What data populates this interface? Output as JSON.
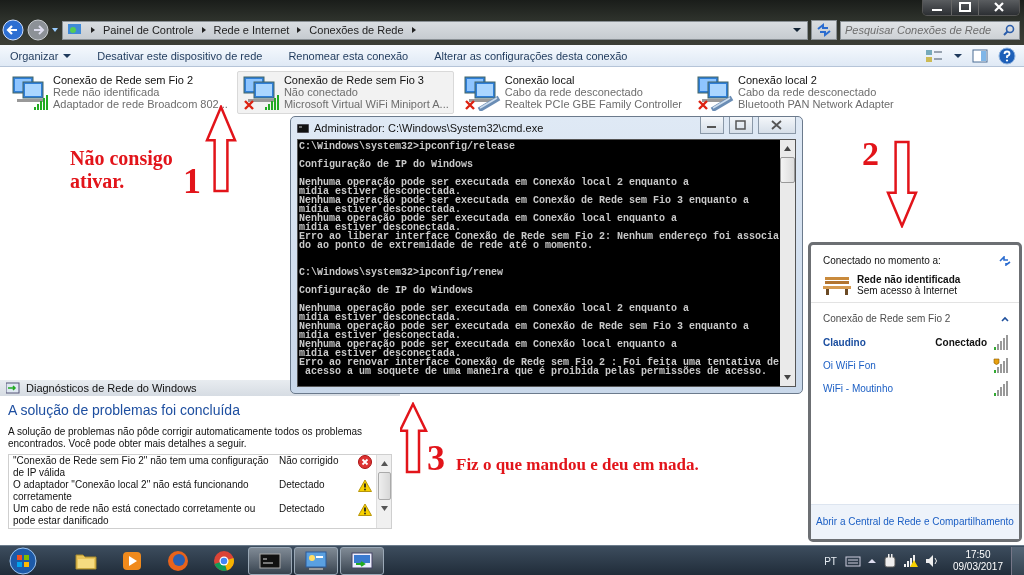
{
  "explorer": {
    "breadcrumb": [
      "Painel de Controle",
      "Rede e Internet",
      "Conexões de Rede"
    ],
    "search": {
      "placeholder": "Pesquisar Conexões de Rede"
    },
    "toolbar": [
      {
        "label": "Organizar",
        "menu": true
      },
      {
        "label": "Desativar este dispositivo de rede",
        "menu": false
      },
      {
        "label": "Renomear esta conexão",
        "menu": false
      },
      {
        "label": "Alterar as configurações desta conexão",
        "menu": false
      }
    ],
    "connections": [
      {
        "name": "Conexão de Rede sem Fio 2",
        "status": "Rede não identificada",
        "adapter": "Adaptador de rede Broadcom 802...",
        "kind": "wireless",
        "disconnected": false,
        "selected": false
      },
      {
        "name": "Conexão de Rede sem Fio 3",
        "status": "Não conectado",
        "adapter": "Microsoft Virtual WiFi Miniport A...",
        "kind": "wireless",
        "disconnected": true,
        "selected": true
      },
      {
        "name": "Conexão local",
        "status": "Cabo da rede desconectado",
        "adapter": "Realtek PCIe GBE Family Controller",
        "kind": "wired",
        "disconnected": true,
        "selected": false
      },
      {
        "name": "Conexão local 2",
        "status": "Cabo da rede desconectado",
        "adapter": "Bluetooth PAN Network Adapter",
        "kind": "wired",
        "disconnected": true,
        "selected": false
      }
    ]
  },
  "cmd": {
    "title": "Administrador: C:\\Windows\\System32\\cmd.exe",
    "sessions": [
      {
        "command": "C:\\Windows\\system32>ipconfig/release",
        "heading": "Configuração de IP do Windows",
        "messages": [
          "Nenhuma operação pode ser executada em Conexão local 2 enquanto a",
          "mídia estiver desconectada.",
          "Nenhuma operação pode ser executada em Conexão de Rede sem Fio 3 enquanto a",
          "mídia estiver desconectada.",
          "Nenhuma operação pode ser executada em Conexão local enquanto a",
          "mídia estiver desconectada.",
          "Erro ao liberar interface Conexão de Rede sem Fio 2: Nenhum endereço foi associa",
          "do ao ponto de extremidade de rede até o momento."
        ]
      },
      {
        "command": "C:\\Windows\\system32>ipconfig/renew",
        "heading": "Configuração de IP do Windows",
        "messages": [
          "Nenhuma operação pode ser executada em Conexão local 2 enquanto a",
          "mídia estiver desconectada.",
          "Nenhuma operação pode ser executada em Conexão de Rede sem Fio 3 enquanto a",
          "mídia estiver desconectada.",
          "Nenhuma operação pode ser executada em Conexão local enquanto a",
          "mídia estiver desconectada.",
          "Erro ao renovar interface Conexão de Rede sem Fio 2 : Foi feita uma tentativa de",
          " acesso a um soquete de uma maneira que é proibida pelas permissões de acesso."
        ]
      }
    ]
  },
  "diagnostics": {
    "title": "Diagnósticos de Rede do Windows",
    "heading": "A solução de problemas foi concluída",
    "description": "A solução de problemas não pôde corrigir automaticamente todos os problemas encontrados. Você pode obter mais detalhes a seguir.",
    "problems": [
      {
        "text": "\"Conexão de Rede sem Fio 2\" não tem uma configuração de IP válida",
        "status": "Não corrigido",
        "kind": "error"
      },
      {
        "text": "O adaptador \"Conexão local 2\" não está funcionando corretamente",
        "status": "Detectado",
        "kind": "warning"
      },
      {
        "text": "Um cabo de rede não está conectado corretamente ou pode estar danificado",
        "status": "Detectado",
        "kind": "warning"
      }
    ]
  },
  "annotations": [
    {
      "number": "1",
      "text": "Não consigo ativar.",
      "kind": "up"
    },
    {
      "number": "2",
      "kind": "down"
    },
    {
      "number": "3",
      "text": "Fiz o que mandou e deu em nada.",
      "kind": "up"
    }
  ],
  "network_flyout": {
    "header": "Conectado no momento a:",
    "network_name": "Rede não identificada",
    "network_status": "Sem acesso à Internet",
    "section": "Conexão de Rede sem Fio 2",
    "expanded": true,
    "networks": [
      {
        "name": "Claudino",
        "connected": true,
        "status": "Conectado",
        "unsecured": false
      },
      {
        "name": "Oi WiFi Fon",
        "connected": false,
        "unsecured": true
      },
      {
        "name": "WiFi - Moutinho",
        "connected": false,
        "unsecured": false
      }
    ],
    "footer_link": "Abrir a Central de Rede e Compartilhamento"
  },
  "taskbar": {
    "apps": [
      {
        "kind": "folder",
        "active": false
      },
      {
        "kind": "media",
        "active": false
      },
      {
        "kind": "firefox",
        "active": false
      },
      {
        "kind": "chrome",
        "active": false
      },
      {
        "kind": "console",
        "active": true
      },
      {
        "kind": "control-panel",
        "active": true
      },
      {
        "kind": "diagnostics",
        "active": true
      }
    ],
    "language": "PT",
    "time": "17:50",
    "date": "09/03/2017"
  }
}
